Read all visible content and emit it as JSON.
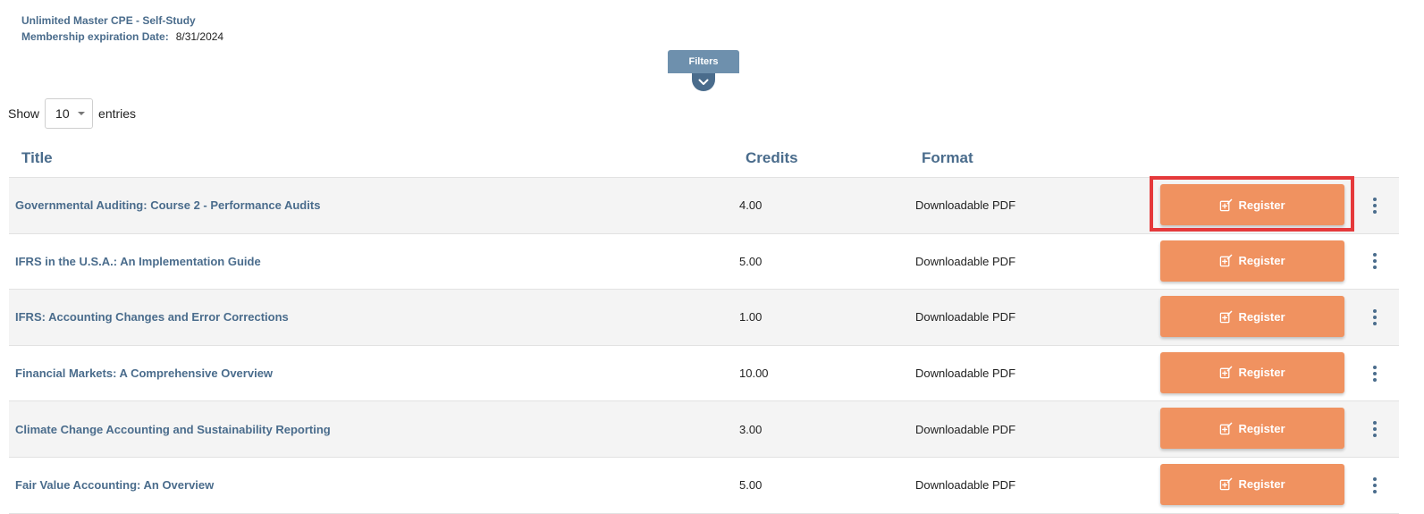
{
  "membership": {
    "name": "Unlimited Master CPE - Self-Study",
    "expiration_label": "Membership expiration Date:",
    "expiration_date": "8/31/2024"
  },
  "filters": {
    "label": "Filters",
    "toggle_icon": "chevron-down-icon"
  },
  "show_entries": {
    "prefix": "Show",
    "value": "10",
    "suffix": "entries"
  },
  "table": {
    "headers": {
      "title": "Title",
      "credits": "Credits",
      "format": "Format"
    },
    "rows": [
      {
        "title": "Governmental Auditing: Course 2 - Performance Audits",
        "credits": "4.00",
        "format": "Downloadable PDF",
        "action": "Register"
      },
      {
        "title": "IFRS in the U.S.A.: An Implementation Guide",
        "credits": "5.00",
        "format": "Downloadable PDF",
        "action": "Register"
      },
      {
        "title": "IFRS: Accounting Changes and Error Corrections",
        "credits": "1.00",
        "format": "Downloadable PDF",
        "action": "Register"
      },
      {
        "title": "Financial Markets: A Comprehensive Overview",
        "credits": "10.00",
        "format": "Downloadable PDF",
        "action": "Register"
      },
      {
        "title": "Climate Change Accounting and Sustainability Reporting",
        "credits": "3.00",
        "format": "Downloadable PDF",
        "action": "Register"
      },
      {
        "title": "Fair Value Accounting: An Overview",
        "credits": "5.00",
        "format": "Downloadable PDF",
        "action": "Register"
      }
    ],
    "register_icon": "register-edit-icon",
    "more_icon": "more-vertical-icon"
  },
  "colors": {
    "accent_blue": "#4a6c8c",
    "filters_tab": "#6e90ad",
    "register_button": "#f09260",
    "highlight": "#e5393b",
    "row_stripe": "#f4f4f4"
  }
}
